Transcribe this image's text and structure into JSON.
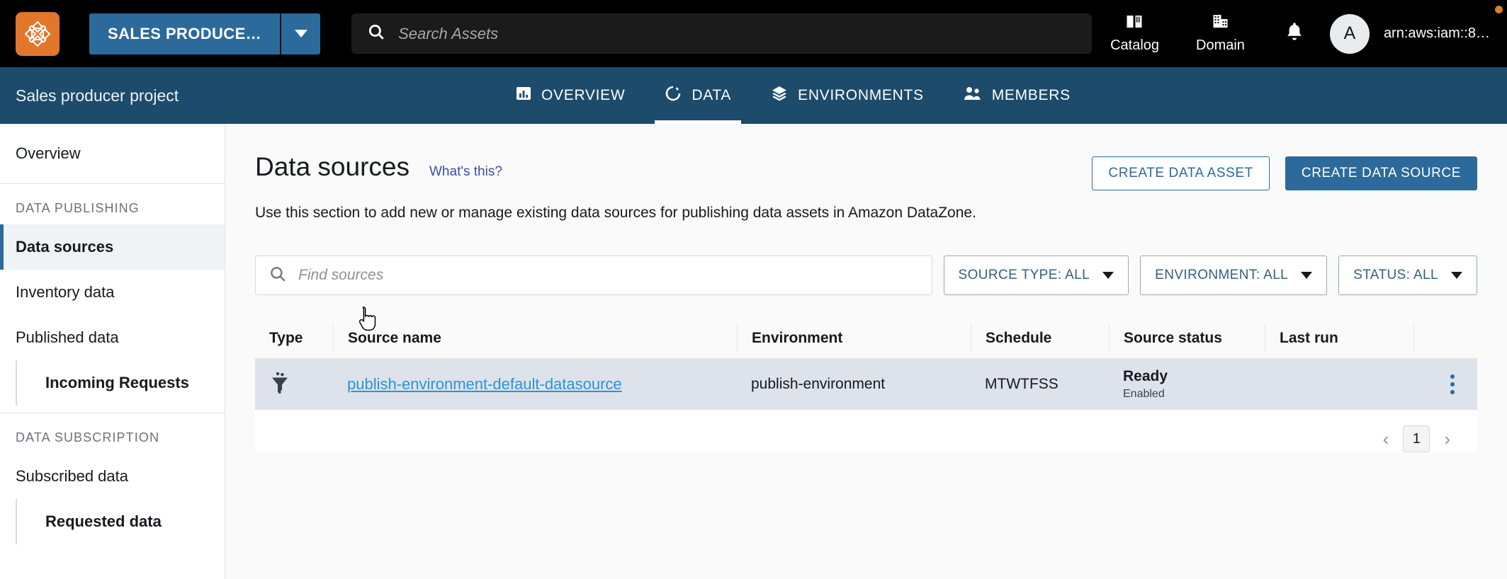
{
  "topbar": {
    "logo_icon": "datazone-logo-icon",
    "project_switcher": {
      "label": "SALES PRODUCE…",
      "caret_icon": "chevron-down-icon"
    },
    "search": {
      "icon": "search-icon",
      "placeholder": "Search Assets",
      "value": ""
    },
    "catalog": {
      "icon": "book-icon",
      "label": "Catalog"
    },
    "domain": {
      "icon": "building-icon",
      "label": "Domain"
    },
    "notifications": {
      "icon": "bell-icon"
    },
    "account": {
      "avatar_initial": "A",
      "arn": "arn:aws:iam::8…"
    }
  },
  "projectnav": {
    "title": "Sales producer project",
    "tabs": [
      {
        "label": "OVERVIEW",
        "icon": "bar-chart-icon",
        "active": false
      },
      {
        "label": "DATA",
        "icon": "circle-dashed-icon",
        "active": true
      },
      {
        "label": "ENVIRONMENTS",
        "icon": "layers-icon",
        "active": false
      },
      {
        "label": "MEMBERS",
        "icon": "people-icon",
        "active": false
      }
    ]
  },
  "sidebar": {
    "overview": "Overview",
    "group_publishing": "DATA PUBLISHING",
    "items_publishing": [
      {
        "label": "Data sources",
        "active": true,
        "sub": false
      },
      {
        "label": "Inventory data",
        "active": false,
        "sub": false
      },
      {
        "label": "Published data",
        "active": false,
        "sub": false
      },
      {
        "label": "Incoming Requests",
        "active": false,
        "sub": true
      }
    ],
    "group_subscription": "DATA SUBSCRIPTION",
    "items_subscription": [
      {
        "label": "Subscribed data",
        "active": false,
        "sub": false
      },
      {
        "label": "Requested data",
        "active": false,
        "sub": true
      }
    ]
  },
  "main": {
    "page_title": "Data sources",
    "whats_this": "What's this?",
    "subtitle": "Use this section to add new or manage existing data sources for publishing data assets in Amazon DataZone.",
    "create_data_asset": "CREATE DATA ASSET",
    "create_data_source": "CREATE DATA SOURCE",
    "find": {
      "icon": "search-icon",
      "placeholder": "Find sources",
      "value": ""
    },
    "filters": [
      {
        "label": "SOURCE TYPE: ALL",
        "icon": "chevron-down-icon"
      },
      {
        "label": "ENVIRONMENT: ALL",
        "icon": "chevron-down-icon"
      },
      {
        "label": "STATUS: ALL",
        "icon": "chevron-down-icon"
      }
    ],
    "table": {
      "columns": [
        "Type",
        "Source name",
        "Environment",
        "Schedule",
        "Source status",
        "Last run",
        ""
      ],
      "rows": [
        {
          "type_icon": "glue-crawler-icon",
          "source_name": "publish-environment-default-datasource",
          "environment": "publish-environment",
          "schedule": "MTWTFSS",
          "status_main": "Ready",
          "status_sub": "Enabled",
          "last_run": "",
          "menu_icon": "kebab-menu-icon"
        }
      ]
    },
    "pagination": {
      "prev_icon": "chevron-left-icon",
      "current_page": "1",
      "next_icon": "chevron-right-icon"
    }
  },
  "colors": {
    "topbar_bg": "#000000",
    "project_nav_bg": "#1d4b6b",
    "accent_blue": "#2c6a9b",
    "logo_orange": "#e2762a",
    "link_blue": "#2a94d6",
    "row_highlight": "#dde2eb"
  }
}
